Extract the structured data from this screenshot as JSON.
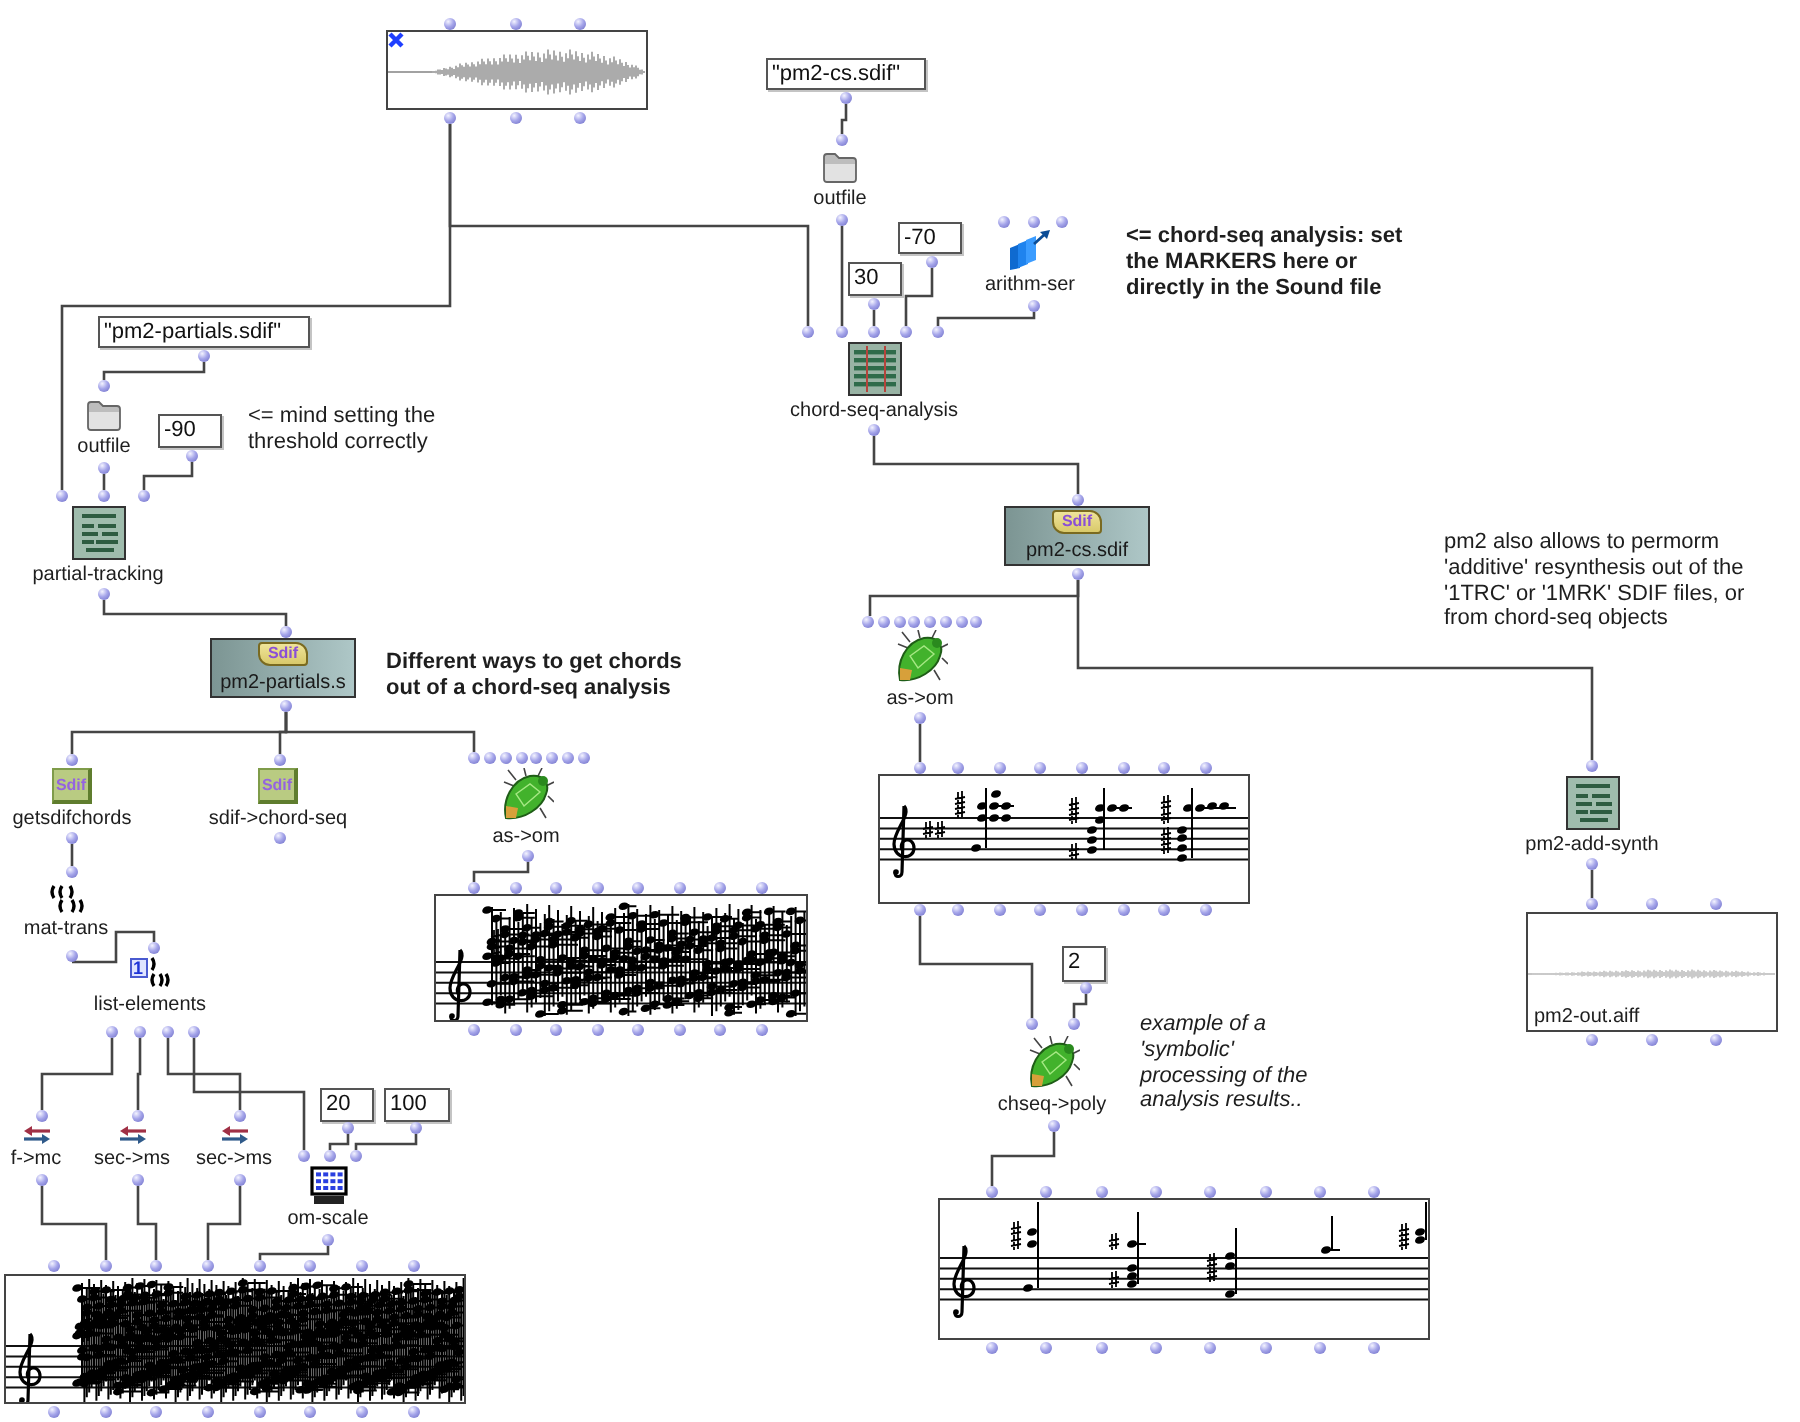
{
  "patch": {
    "boxes": [
      {
        "kind": "sound",
        "locked": true
      },
      {
        "kind": "text",
        "value": "\"pm2-cs.sdif\"",
        "locked": false
      },
      {
        "kind": "file",
        "label": "outfile",
        "locked": false
      },
      {
        "kind": "number",
        "value": "-70",
        "locked": false
      },
      {
        "kind": "number",
        "value": "30",
        "locked": false
      },
      {
        "kind": "series",
        "label": "arithm-ser",
        "locked": false
      },
      {
        "kind": "segmentation",
        "label": "chord-seq-analysis",
        "locked": false
      },
      {
        "kind": "sdiffile",
        "logo": "Sdif",
        "label": "pm2-cs.sdif",
        "locked": false
      },
      {
        "kind": "text",
        "value": "\"pm2-partials.sdif\"",
        "locked": false
      },
      {
        "kind": "file",
        "label": "outfile",
        "locked": false
      },
      {
        "kind": "number",
        "value": "-90",
        "locked": false
      },
      {
        "kind": "pm2",
        "label": "partial-tracking",
        "locked": false
      },
      {
        "kind": "sdiffile",
        "logo": "Sdif",
        "label": "pm2-partials.s",
        "locked": false
      },
      {
        "kind": "sdif",
        "logo": "Sdif",
        "label": "getsdifchords",
        "locked": false
      },
      {
        "kind": "sdif",
        "logo": "Sdif",
        "label": "sdif->chord-seq",
        "locked": false
      },
      {
        "kind": "converter",
        "label": "as->om",
        "locked": false
      },
      {
        "kind": "chordseq",
        "locked": false
      },
      {
        "kind": "matrix",
        "label": "mat-trans",
        "locked": false
      },
      {
        "kind": "nth",
        "index": "1",
        "label": "list-elements",
        "locked": false
      },
      {
        "kind": "conversion",
        "label": "f->mc",
        "locked": false
      },
      {
        "kind": "conversion",
        "label": "sec->ms",
        "locked": false
      },
      {
        "kind": "conversion",
        "label": "sec->ms",
        "locked": false
      },
      {
        "kind": "number",
        "value": "20",
        "locked": false
      },
      {
        "kind": "number",
        "value": "100",
        "locked": false
      },
      {
        "kind": "scale",
        "label": "om-scale",
        "locked": false
      },
      {
        "kind": "chordseq",
        "locked": false
      },
      {
        "kind": "converter",
        "label": "as->om",
        "locked": false
      },
      {
        "kind": "chordseq",
        "locked": false
      },
      {
        "kind": "pm2",
        "label": "pm2-add-synth",
        "locked": false
      },
      {
        "kind": "sound",
        "label": "pm2-out.aiff",
        "locked": false
      },
      {
        "kind": "number",
        "value": "2",
        "locked": false
      },
      {
        "kind": "converter",
        "label": "chseq->poly",
        "locked": false
      },
      {
        "kind": "poly",
        "locked": false
      }
    ],
    "comments": [
      {
        "kind": "bold",
        "text": "<= chord-seq analysis: set\nthe MARKERS here or\ndirectly in the Sound file"
      },
      {
        "kind": "plain",
        "text": "<= mind setting the\nthreshold correctly"
      },
      {
        "kind": "bold",
        "text": "Different ways to get chords\nout of a chord-seq analysis"
      },
      {
        "kind": "plain",
        "text": "pm2 also allows to permorm\n'additive' resynthesis out of the\n'1TRC' or '1MRK' SDIF files, or\nfrom chord-seq objects"
      },
      {
        "kind": "italic",
        "text": "example of a\n'symbolic'\nprocessing of the\nanalysis results.."
      }
    ]
  }
}
